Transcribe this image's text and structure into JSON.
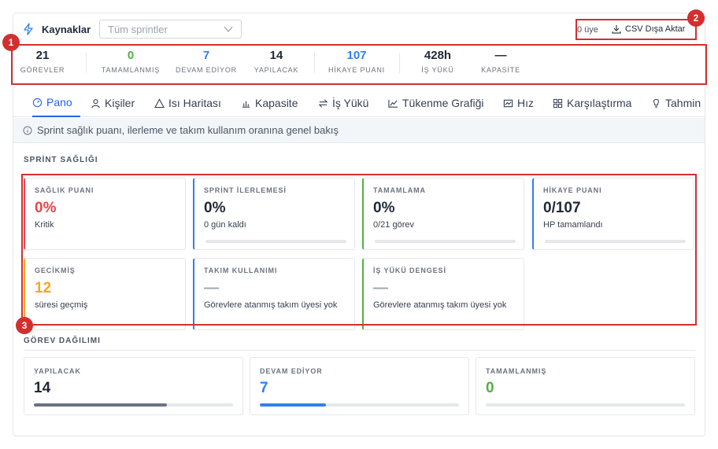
{
  "header": {
    "title": "Kaynaklar",
    "sprint_placeholder": "Tüm sprintler",
    "member_count": "0 üye",
    "csv_label": "CSV Dışa Aktar"
  },
  "stats": [
    {
      "value": "21",
      "label": "GÖREVLER",
      "color": "#1f2937"
    },
    {
      "value": "0",
      "label": "TAMAMLANMIŞ",
      "color": "#52b043"
    },
    {
      "value": "7",
      "label": "DEVAM EDİYOR",
      "color": "#2f80ed"
    },
    {
      "value": "14",
      "label": "YAPILACAK",
      "color": "#1f2937"
    },
    {
      "value": "107",
      "label": "HİKAYE PUANI",
      "color": "#2f80ed"
    },
    {
      "value": "428h",
      "label": "İŞ YÜKÜ",
      "color": "#1f2937"
    },
    {
      "value": "—",
      "label": "KAPASİTE",
      "color": "#1f2937"
    }
  ],
  "tabs": [
    {
      "label": "Pano",
      "icon": "gauge-icon",
      "active": true
    },
    {
      "label": "Kişiler",
      "icon": "user-icon"
    },
    {
      "label": "Isı Haritası",
      "icon": "warning-icon"
    },
    {
      "label": "Kapasite",
      "icon": "bar-chart-icon"
    },
    {
      "label": "İş Yükü",
      "icon": "arrows-icon"
    },
    {
      "label": "Tükenme Grafiği",
      "icon": "line-chart-icon"
    },
    {
      "label": "Hız",
      "icon": "area-chart-icon"
    },
    {
      "label": "Karşılaştırma",
      "icon": "grid-icon"
    },
    {
      "label": "Tahmin",
      "icon": "bulb-icon"
    }
  ],
  "info_text": "Sprint sağlık puanı, ilerleme ve takım kullanım oranına genel bakış",
  "health": {
    "section_title": "SPRİNT SAĞLIĞI",
    "cards": [
      {
        "label": "SAĞLIK PUANI",
        "value": "0%",
        "sub": "Kritik",
        "accent": "#e5484d",
        "value_color": "#e5484d",
        "bar": false
      },
      {
        "label": "SPRİNT İLERLEMESİ",
        "value": "0%",
        "sub": "0 gün kaldı",
        "accent": "#2f80ed",
        "value_color": "#1f2937",
        "bar": true
      },
      {
        "label": "TAMAMLAMA",
        "value": "0%",
        "sub": "0/21 görev",
        "accent": "#52b043",
        "value_color": "#1f2937",
        "bar": true
      },
      {
        "label": "HİKAYE PUANI",
        "value": "0/107",
        "sub": "HP tamamlandı",
        "accent": "#2f80ed",
        "value_color": "#1f2937",
        "bar": true
      },
      {
        "label": "GECİKMİŞ",
        "value": "12",
        "sub": "süresi geçmiş",
        "accent": "#f5a623",
        "value_color": "#f5a623",
        "bar": false
      },
      {
        "label": "TAKIM KULLANIMI",
        "value": "—",
        "sub": "Görevlere atanmış takım üyesi yok",
        "accent": "#2f80ed",
        "value_color": "#9ca3af",
        "bar": false
      },
      {
        "label": "İŞ YÜKÜ DENGESİ",
        "value": "—",
        "sub": "Görevlere atanmış takım üyesi yok",
        "accent": "#52b043",
        "value_color": "#9ca3af",
        "bar": false
      }
    ]
  },
  "distribution": {
    "section_title": "GÖREV DAĞILIMI",
    "cards": [
      {
        "label": "YAPILACAK",
        "value": "14",
        "value_color": "#1f2937",
        "fill": 0.667,
        "fill_color": "#6b7280"
      },
      {
        "label": "DEVAM EDİYOR",
        "value": "7",
        "value_color": "#2f80ed",
        "fill": 0.333,
        "fill_color": "#2f80ed"
      },
      {
        "label": "TAMAMLANMIŞ",
        "value": "0",
        "value_color": "#52b043",
        "fill": 0,
        "fill_color": "#52b043"
      }
    ]
  },
  "annotations": [
    "1",
    "2",
    "3"
  ]
}
